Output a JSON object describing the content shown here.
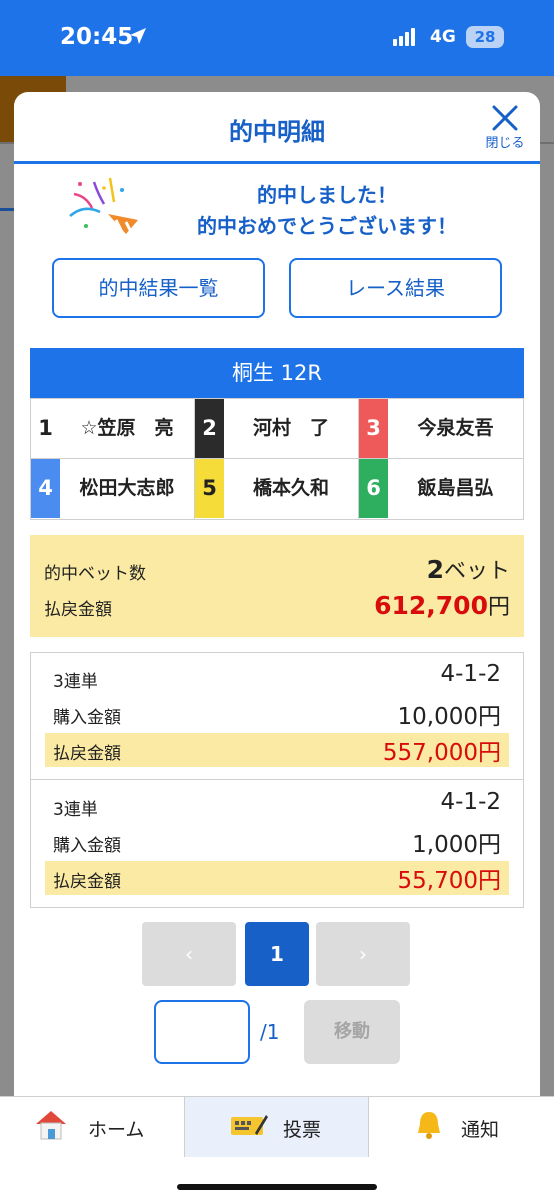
{
  "status": {
    "time": "20:45",
    "network": "4G",
    "battery": "28"
  },
  "modal": {
    "title": "的中明細",
    "close_label": "閉じる",
    "congrats_line1": "的中しました！",
    "congrats_line2": "的中おめでとうございます！",
    "btn_results_list": "的中結果一覧",
    "btn_race_results": "レース結果"
  },
  "race": {
    "title": "桐生 12R",
    "racers": [
      {
        "num": "1",
        "name": "☆笠原　亮",
        "color": "#ffffff",
        "text_color": "#222222"
      },
      {
        "num": "2",
        "name": "河村　了",
        "color": "#2b2b2b",
        "text_color": "#ffffff"
      },
      {
        "num": "3",
        "name": "今泉友吾",
        "color": "#ee5a5a",
        "text_color": "#ffffff"
      },
      {
        "num": "4",
        "name": "松田大志郎",
        "color": "#4a8cf0",
        "text_color": "#ffffff"
      },
      {
        "num": "5",
        "name": "橋本久和",
        "color": "#f5dc38",
        "text_color": "#222222"
      },
      {
        "num": "6",
        "name": "飯島昌弘",
        "color": "#2eae5f",
        "text_color": "#ffffff"
      }
    ]
  },
  "summary": {
    "bets_label": "的中ベット数",
    "bets_value": "2",
    "bets_unit": "ベット",
    "payout_label": "払戻金額",
    "payout_value": "612,700",
    "payout_unit": "円"
  },
  "bets": [
    {
      "type": "3連単",
      "combo": "4-1-2",
      "purchase_label": "購入金額",
      "purchase": "10,000円",
      "payout_label": "払戻金額",
      "payout": "557,000円"
    },
    {
      "type": "3連単",
      "combo": "4-1-2",
      "purchase_label": "購入金額",
      "purchase": "1,000円",
      "payout_label": "払戻金額",
      "payout": "55,700円"
    }
  ],
  "pager": {
    "prev": "‹",
    "current": "1",
    "next": "›",
    "total": "/1",
    "go": "移動"
  },
  "tabs": [
    {
      "label": "ホーム",
      "icon": "home-icon"
    },
    {
      "label": "投票",
      "icon": "ticket-icon"
    },
    {
      "label": "通知",
      "icon": "bell-icon"
    }
  ]
}
